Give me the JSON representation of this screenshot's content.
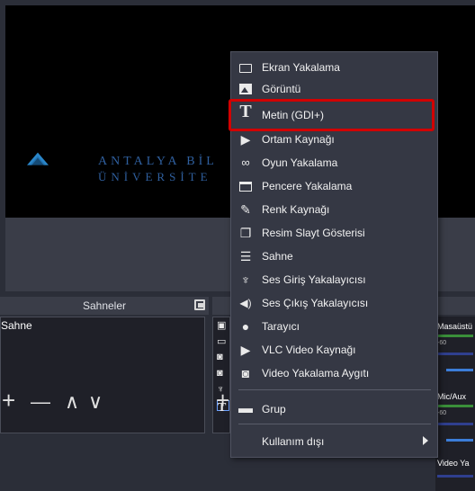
{
  "preview": {
    "logo_line1": "ANTALYA BİL",
    "logo_line2": "ÜNİVERSİTE"
  },
  "scenes_dock": {
    "title": "Sahneler",
    "items": [
      "Sahne"
    ],
    "add_label": "+",
    "remove_label": "—",
    "up_label": "∧",
    "down_label": "∨"
  },
  "sources_dock": {
    "add_label": "+"
  },
  "mixer": {
    "channels": [
      {
        "label": "Masaüstü",
        "scale": "-60"
      },
      {
        "label": "Mic/Aux",
        "scale": "-60"
      },
      {
        "label": "Video Ya",
        "scale": ""
      }
    ]
  },
  "context_menu": {
    "items": [
      {
        "label": "Ekran Yakalama",
        "icon": "monitor-icon"
      },
      {
        "label": "Görüntü",
        "icon": "image-icon"
      },
      {
        "label": "Metin (GDI+)",
        "icon": "text-icon",
        "highlighted": true
      },
      {
        "label": "Ortam Kaynağı",
        "icon": "play-icon"
      },
      {
        "label": "Oyun Yakalama",
        "icon": "gamepad-icon"
      },
      {
        "label": "Pencere Yakalama",
        "icon": "window-icon"
      },
      {
        "label": "Renk Kaynağı",
        "icon": "brush-icon"
      },
      {
        "label": "Resim Slayt Gösterisi",
        "icon": "slideshow-icon"
      },
      {
        "label": "Sahne",
        "icon": "list-icon"
      },
      {
        "label": "Ses Giriş Yakalayıcısı",
        "icon": "microphone-icon"
      },
      {
        "label": "Ses Çıkış Yakalayıcısı",
        "icon": "speaker-icon"
      },
      {
        "label": "Tarayıcı",
        "icon": "globe-icon"
      },
      {
        "label": "VLC Video Kaynağı",
        "icon": "play-icon"
      },
      {
        "label": "Video Yakalama Aygıtı",
        "icon": "camera-icon"
      },
      {
        "label": "Grup",
        "icon": "folder-icon"
      },
      {
        "label": "Kullanım dışı",
        "icon": "submenu-arrow-icon"
      }
    ]
  },
  "colors": {
    "highlight_border": "#d20000",
    "menu_bg": "#353844",
    "app_bg": "#2b2e38"
  }
}
